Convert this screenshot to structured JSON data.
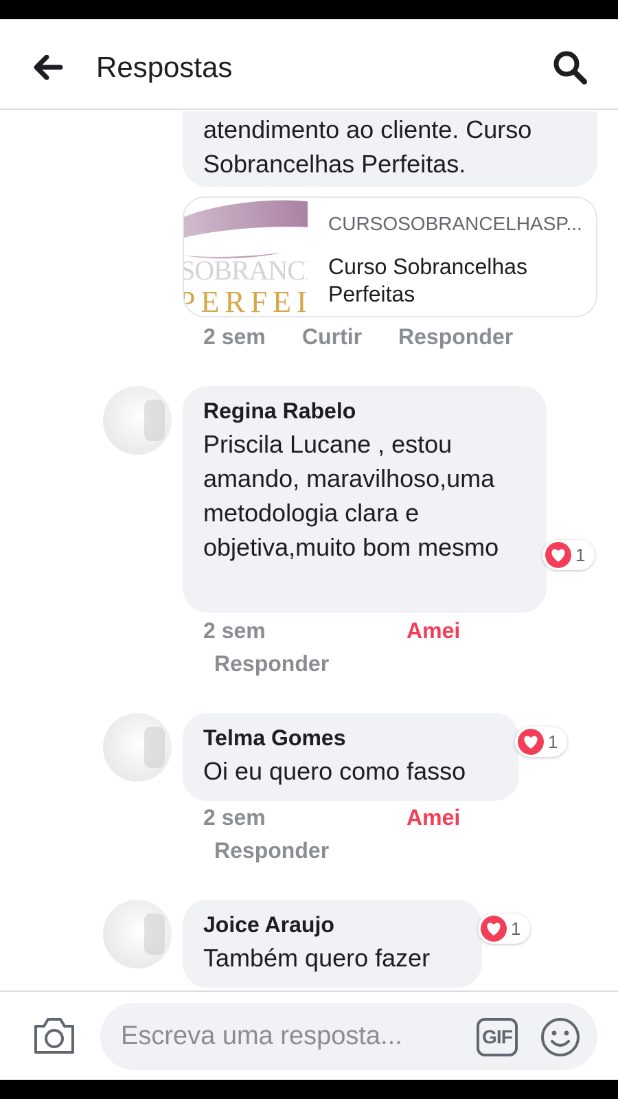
{
  "header": {
    "title": "Respostas",
    "back_icon": "arrow-left-icon",
    "search_icon": "search-icon"
  },
  "thread": {
    "first_comment": {
      "text_lines": [
        "atendimento ao cliente. Curso",
        "Sobrancelhas Perfeitas."
      ],
      "link_card": {
        "domain": "CURSOSOBRANCELHASP...",
        "title": "Curso Sobrancelhas Perfeitas",
        "thumb_text_1": "SOBRANCELHAS",
        "thumb_text_2": "PERFEITAS"
      },
      "time": "2 sem",
      "like_label": "Curtir",
      "reply_label": "Responder"
    },
    "replies": [
      {
        "name": "Regina Rabelo",
        "text": "Priscila Lucane , estou amando, maravilhoso,uma metodologia clara e objetiva,muito bom mesmo",
        "reaction_count": "1",
        "time": "2 sem",
        "reaction_label": "Amei",
        "reply_label": "Responder"
      },
      {
        "name": "Telma Gomes",
        "text": "Oi eu quero como fasso",
        "reaction_count": "1",
        "time": "2 sem",
        "reaction_label": "Amei",
        "reply_label": "Responder"
      },
      {
        "name": "Joice Araujo",
        "text": "Também quero fazer",
        "reaction_count": "1"
      }
    ]
  },
  "composer": {
    "placeholder": "Escreva uma resposta...",
    "gif_label": "GIF",
    "camera_icon": "camera-icon",
    "emoji_icon": "smiley-icon"
  },
  "colors": {
    "bubble": "#f0f2f5",
    "love": "#f33e58",
    "meta": "#8a8d91"
  }
}
